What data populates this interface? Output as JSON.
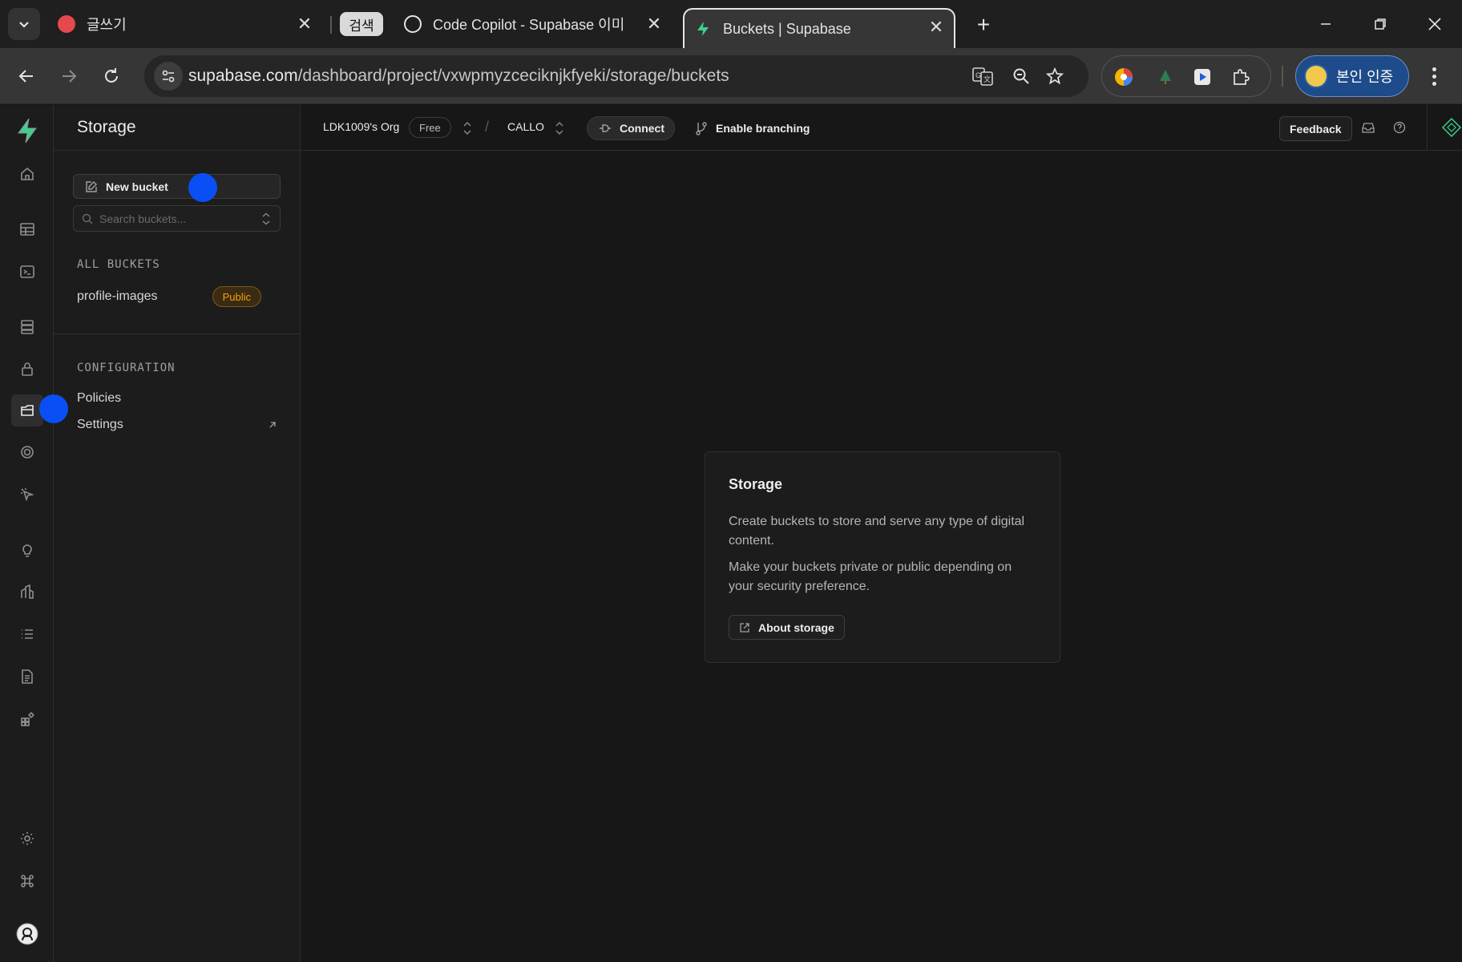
{
  "browser": {
    "tabs": [
      {
        "title": "글쓰기"
      },
      {
        "title": "Code Copilot - Supabase 이미",
        "search_pill": "검색"
      },
      {
        "title": "Buckets | Supabase"
      }
    ],
    "url_host": "supabase.com",
    "url_path": "/dashboard/project/vxwpmyzceciknjkfyeki/storage/buckets",
    "profile_label": "본인 인증"
  },
  "sidebar": {
    "title": "Storage",
    "new_bucket_label": "New bucket",
    "search_placeholder": "Search buckets...",
    "all_buckets_label": "ALL BUCKETS",
    "buckets": [
      {
        "name": "profile-images",
        "badge": "Public"
      }
    ],
    "configuration_label": "CONFIGURATION",
    "config_items": [
      {
        "label": "Policies"
      },
      {
        "label": "Settings"
      }
    ]
  },
  "topbar": {
    "org": "LDK1009's Org",
    "plan": "Free",
    "project": "CALLO",
    "connect_label": "Connect",
    "branching_label": "Enable branching",
    "feedback_label": "Feedback"
  },
  "empty_state": {
    "title": "Storage",
    "paragraph_1": "Create buckets to store and serve any type of digital content.",
    "paragraph_2": "Make your buckets private or public depending on your security preference.",
    "about_label": "About storage"
  },
  "colors": {
    "brand": "#3ecf8e",
    "public_badge": "#f1a10d",
    "cursor_marker": "#0a4ff5"
  }
}
